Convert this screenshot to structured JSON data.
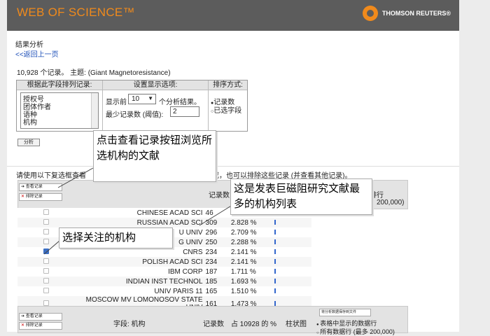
{
  "header": {
    "logo": "WEB OF SCIENCE™",
    "brand": "THOMSON REUTERS®"
  },
  "page": {
    "title": "结果分析",
    "back_link": "<<返回上一页",
    "summary": "10,928 个记录。 主题: (Giant Magnetoresistance)"
  },
  "panels": {
    "rank_field_title": "根据此字段排列记录:",
    "rank_field_options": [
      "授权号",
      "团体作者",
      "语种",
      "机构"
    ],
    "settings_title": "设置显示选项:",
    "show_prefix": "显示前",
    "show_value": "10",
    "show_suffix": "个分析结果。",
    "min_count_label": "最少记录数 (阈值):",
    "min_count_value": "2",
    "sort_title": "排序方式:",
    "sort_options": [
      "记录数",
      "已选字段"
    ],
    "analyze_button": "分析"
  },
  "instructions": "请使用以下复选框查看",
  "instructions_tail": "或，也可以排除这些记录 (并查看其他记录)。",
  "table": {
    "buttons": {
      "view": "查看记录",
      "exclude": "排除记录"
    },
    "header_count_fragment": "记录数",
    "export": {
      "partial_line": "排行",
      "partial_range": "200,000)"
    },
    "rows": [
      {
        "name": "CHINESE ACAD SCI",
        "count": "46",
        "percent": "",
        "checked": false,
        "bar": 0.98
      },
      {
        "name": "RUSSIAN ACAD SCI",
        "count": "309",
        "percent": "2.828 %",
        "checked": false,
        "bar": 0.6
      },
      {
        "name": "U UNIV",
        "count": "296",
        "percent": "2.709 %",
        "checked": false,
        "bar": 0.57
      },
      {
        "name": "G UNIV",
        "count": "250",
        "percent": "2.288 %",
        "checked": false,
        "bar": 0.48
      },
      {
        "name": "CNRS",
        "count": "234",
        "percent": "2.141 %",
        "checked": true,
        "bar": 0.45
      },
      {
        "name": "POLISH ACAD SCI",
        "count": "234",
        "percent": "2.141 %",
        "checked": false,
        "bar": 0.45
      },
      {
        "name": "IBM CORP",
        "count": "187",
        "percent": "1.711 %",
        "checked": false,
        "bar": 0.36
      },
      {
        "name": "INDIAN INST TECHNOL",
        "count": "185",
        "percent": "1.693 %",
        "checked": false,
        "bar": 0.36
      },
      {
        "name": "UNIV PARIS 11",
        "count": "165",
        "percent": "1.510 %",
        "checked": false,
        "bar": 0.32
      },
      {
        "name": "MOSCOW MV LOMONOSOV STATE UNIV",
        "count": "161",
        "percent": "1.473 %",
        "checked": false,
        "bar": 0.31
      }
    ],
    "footer": {
      "field_label": "字段: 机构",
      "count_label": "记录数",
      "percent_label": "占 10928 的 %",
      "bar_label": "柱状图",
      "save_button": "将分析数据保存到文件",
      "option1": "表格中显示的数据行",
      "option2": "所有数据行 (最多 200,000)"
    }
  },
  "callouts": {
    "view_records": "点击查看记录按钮浏览所选机构的文献",
    "top_list": "这是发表巨磁阻研究文献最多的机构列表",
    "select_org": "选择关注的机构"
  },
  "colors": {
    "header_bg": "#5c5c5c",
    "logo_orange": "#f08a1c",
    "link_blue": "#1d4fb8",
    "bar_blue": "#3366cc"
  }
}
